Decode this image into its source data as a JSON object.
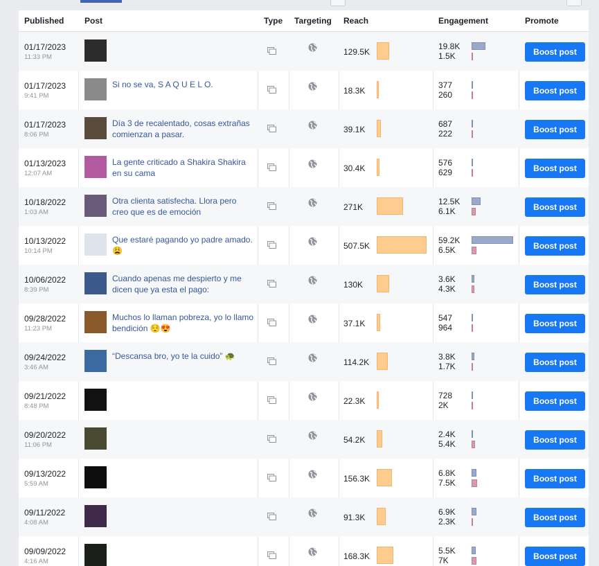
{
  "header": {
    "published": "Published",
    "post": "Post",
    "type": "Type",
    "targeting": "Targeting",
    "reach": "Reach",
    "engagement": "Engagement",
    "promote": "Promote"
  },
  "colors": {
    "boost_button": "#1877f2",
    "reach_bar": "#ffcc8f",
    "engagement_bar_1": "#9ca8c8",
    "engagement_bar_2": "#d89aac",
    "post_link": "#365899"
  },
  "icons": {
    "type": "multi-photo-icon",
    "targeting": "globe-icon"
  },
  "rows": [
    {
      "date": "01/17/2023",
      "time": "11:33 PM",
      "text": "",
      "thumb": "#2c2c2c",
      "reach": "129.5K",
      "reach_num": 129.5,
      "eng1": "19.8K",
      "eng1_num": 19.8,
      "eng2": "1.5K",
      "eng2_num": 1.5,
      "boost": "Boost post"
    },
    {
      "date": "01/17/2023",
      "time": "9:41 PM",
      "text": "Si no se va, S A Q U E L O.",
      "thumb": "#8a8a8a",
      "reach": "18.3K",
      "reach_num": 18.3,
      "eng1": "377",
      "eng1_num": 0.377,
      "eng2": "260",
      "eng2_num": 0.26,
      "boost": "Boost post"
    },
    {
      "date": "01/17/2023",
      "time": "8:06 PM",
      "text": "Día 3 de recalentado, cosas extrañas comienzan a pasar.",
      "thumb": "#5a4a3c",
      "reach": "39.1K",
      "reach_num": 39.1,
      "eng1": "687",
      "eng1_num": 0.687,
      "eng2": "222",
      "eng2_num": 0.222,
      "boost": "Boost post"
    },
    {
      "date": "01/13/2023",
      "time": "12:07 AM",
      "text": "La gente criticado a Shakira Shakira en su cama",
      "thumb": "#b25aa0",
      "reach": "30.4K",
      "reach_num": 30.4,
      "eng1": "576",
      "eng1_num": 0.576,
      "eng2": "629",
      "eng2_num": 0.629,
      "boost": "Boost post"
    },
    {
      "date": "10/18/2022",
      "time": "1:03 AM",
      "text": "Otra clienta satisfecha. Llora pero creo que es de emoción",
      "thumb": "#6a5a7a",
      "reach": "271K",
      "reach_num": 271,
      "eng1": "12.5K",
      "eng1_num": 12.5,
      "eng2": "6.1K",
      "eng2_num": 6.1,
      "boost": "Boost post"
    },
    {
      "date": "10/13/2022",
      "time": "10:14 PM",
      "text": "Que estaré pagando yo padre amado. 😩",
      "thumb": "#dfe3ec",
      "reach": "507.5K",
      "reach_num": 507.5,
      "eng1": "59.2K",
      "eng1_num": 59.2,
      "eng2": "6.5K",
      "eng2_num": 6.5,
      "boost": "Boost post"
    },
    {
      "date": "10/06/2022",
      "time": "8:39 PM",
      "text": "Cuando apenas me despierto y me dicen que ya esta el pago:",
      "thumb": "#3b5a8a",
      "reach": "130K",
      "reach_num": 130,
      "eng1": "3.6K",
      "eng1_num": 3.6,
      "eng2": "4.3K",
      "eng2_num": 4.3,
      "boost": "Boost post"
    },
    {
      "date": "09/28/2022",
      "time": "11:23 PM",
      "text": "Muchos lo llaman pobreza, yo lo llamo bendición 😌😍",
      "thumb": "#8a5a2a",
      "reach": "37.1K",
      "reach_num": 37.1,
      "eng1": "547",
      "eng1_num": 0.547,
      "eng2": "964",
      "eng2_num": 0.964,
      "boost": "Boost post"
    },
    {
      "date": "09/24/2022",
      "time": "3:46 AM",
      "text": "“Descansa bro, yo te la cuido” 🐢",
      "thumb": "#3a6aa0",
      "reach": "114.2K",
      "reach_num": 114.2,
      "eng1": "3.8K",
      "eng1_num": 3.8,
      "eng2": "1.7K",
      "eng2_num": 1.7,
      "boost": "Boost post"
    },
    {
      "date": "09/21/2022",
      "time": "8:48 PM",
      "text": "",
      "thumb": "#111111",
      "reach": "22.3K",
      "reach_num": 22.3,
      "eng1": "728",
      "eng1_num": 0.728,
      "eng2": "2K",
      "eng2_num": 2,
      "boost": "Boost post"
    },
    {
      "date": "09/20/2022",
      "time": "11:06 PM",
      "text": "",
      "thumb": "#4a4a30",
      "reach": "54.2K",
      "reach_num": 54.2,
      "eng1": "2.4K",
      "eng1_num": 2.4,
      "eng2": "5.4K",
      "eng2_num": 5.4,
      "boost": "Boost post"
    },
    {
      "date": "09/13/2022",
      "time": "5:59 AM",
      "text": "",
      "thumb": "#0e0e0e",
      "reach": "156.3K",
      "reach_num": 156.3,
      "eng1": "6.8K",
      "eng1_num": 6.8,
      "eng2": "7.5K",
      "eng2_num": 7.5,
      "boost": "Boost post"
    },
    {
      "date": "09/11/2022",
      "time": "4:08 AM",
      "text": "",
      "thumb": "#402a4a",
      "reach": "91.3K",
      "reach_num": 91.3,
      "eng1": "6.9K",
      "eng1_num": 6.9,
      "eng2": "2.3K",
      "eng2_num": 2.3,
      "boost": "Boost post"
    },
    {
      "date": "09/09/2022",
      "time": "4:16 AM",
      "text": "",
      "thumb": "#1a1f1a",
      "reach": "168.3K",
      "reach_num": 168.3,
      "eng1": "5.5K",
      "eng1_num": 5.5,
      "eng2": "7K",
      "eng2_num": 7,
      "boost": "Boost post"
    }
  ]
}
